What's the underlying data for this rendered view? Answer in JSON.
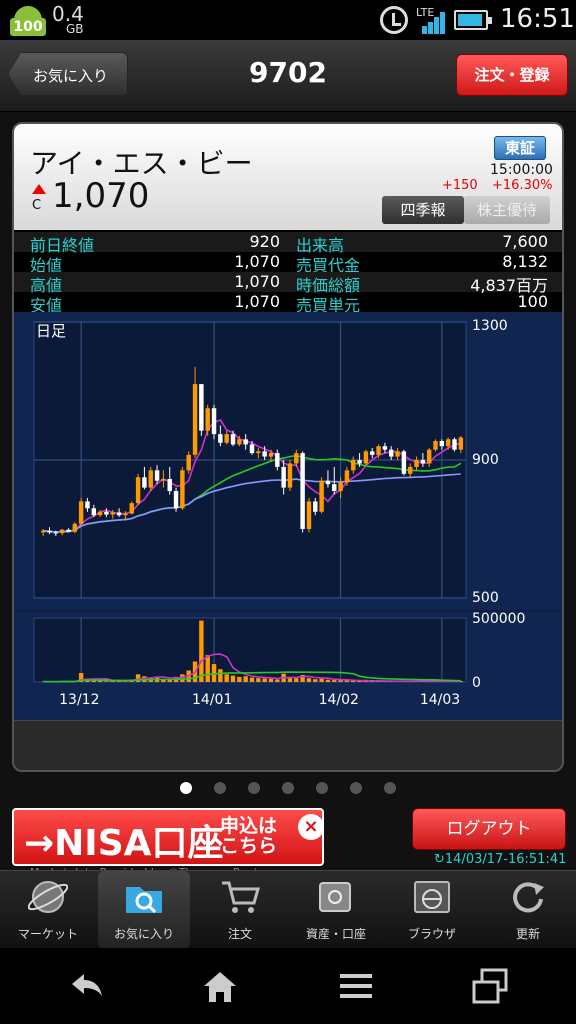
{
  "status_bar": {
    "android_badge": "100",
    "memory": "0.4",
    "memory_unit": "GB",
    "network": "LTE",
    "time": "16:51"
  },
  "header": {
    "back_label": "お気に入り",
    "title": "9702",
    "order_label": "注文・登録"
  },
  "stock": {
    "name": "アイ・エス・ビー",
    "c_mark": "C",
    "price": "1,070",
    "exchange": "東証",
    "price_time": "15:00:00",
    "change": "+150",
    "change_pct": "+16.30%",
    "tab_quarterly": "四季報",
    "tab_yutai": "株主優待"
  },
  "stats": [
    {
      "k1": "前日終値",
      "v1": "920",
      "k2": "出来高",
      "v2": "7,600"
    },
    {
      "k1": "始値",
      "v1": "1,070",
      "k2": "売買代金",
      "v2": "8,132"
    },
    {
      "k1": "高値",
      "v1": "1,070",
      "k2": "時価総額",
      "v2": "4,837百万"
    },
    {
      "k1": "安値",
      "v1": "1,070",
      "k2": "売買単元",
      "v2": "100"
    }
  ],
  "chart": {
    "label": "日足",
    "price_axis": [
      "1300",
      "900",
      "500"
    ],
    "volume_axis": [
      "500000",
      "0"
    ],
    "months": [
      "13/12",
      "14/01",
      "14/02",
      "14/03"
    ],
    "up_color": "#ff9900",
    "down_color": "#ffffff",
    "ma_short_color": "#cc33cc",
    "ma_mid_color": "#22cc22",
    "ma_long_color": "#8899ff"
  },
  "chart_data": {
    "type": "candlestick",
    "price_ticks": [
      1300,
      900,
      500
    ],
    "volume_ticks": [
      500000,
      0
    ],
    "x_tick_labels": [
      "13/12",
      "14/01",
      "14/02",
      "14/03"
    ],
    "ylim": [
      500,
      1300
    ],
    "volume_ylim": [
      0,
      500000
    ],
    "candles": [
      [
        690,
        700,
        680,
        695
      ],
      [
        695,
        705,
        685,
        690
      ],
      [
        690,
        695,
        680,
        688
      ],
      [
        688,
        700,
        682,
        698
      ],
      [
        698,
        702,
        690,
        692
      ],
      [
        692,
        720,
        688,
        715
      ],
      [
        715,
        790,
        710,
        780
      ],
      [
        780,
        790,
        750,
        760
      ],
      [
        760,
        770,
        735,
        740
      ],
      [
        740,
        755,
        735,
        750
      ],
      [
        750,
        760,
        735,
        742
      ],
      [
        742,
        755,
        730,
        748
      ],
      [
        748,
        760,
        735,
        740
      ],
      [
        740,
        752,
        725,
        745
      ],
      [
        745,
        780,
        742,
        775
      ],
      [
        775,
        860,
        770,
        850
      ],
      [
        850,
        880,
        815,
        820
      ],
      [
        820,
        880,
        810,
        870
      ],
      [
        870,
        885,
        830,
        840
      ],
      [
        840,
        870,
        820,
        845
      ],
      [
        845,
        880,
        800,
        810
      ],
      [
        810,
        820,
        750,
        760
      ],
      [
        760,
        880,
        755,
        870
      ],
      [
        870,
        925,
        860,
        915
      ],
      [
        915,
        1170,
        905,
        1120
      ],
      [
        1120,
        1090,
        970,
        985
      ],
      [
        985,
        1060,
        970,
        1050
      ],
      [
        1050,
        1060,
        960,
        975
      ],
      [
        975,
        1000,
        940,
        950
      ],
      [
        950,
        985,
        945,
        975
      ],
      [
        975,
        985,
        940,
        945
      ],
      [
        945,
        970,
        940,
        960
      ],
      [
        960,
        975,
        930,
        945
      ],
      [
        945,
        955,
        915,
        920
      ],
      [
        920,
        935,
        905,
        925
      ],
      [
        925,
        940,
        900,
        910
      ],
      [
        910,
        930,
        895,
        920
      ],
      [
        920,
        930,
        870,
        880
      ],
      [
        880,
        900,
        800,
        820
      ],
      [
        820,
        900,
        810,
        890
      ],
      [
        890,
        930,
        880,
        920
      ],
      [
        920,
        925,
        690,
        700
      ],
      [
        700,
        790,
        690,
        780
      ],
      [
        780,
        790,
        740,
        750
      ],
      [
        750,
        850,
        745,
        840
      ],
      [
        840,
        870,
        820,
        830
      ],
      [
        830,
        880,
        800,
        810
      ],
      [
        810,
        850,
        790,
        835
      ],
      [
        835,
        880,
        825,
        870
      ],
      [
        870,
        910,
        860,
        900
      ],
      [
        900,
        920,
        880,
        890
      ],
      [
        890,
        930,
        885,
        925
      ],
      [
        925,
        935,
        905,
        915
      ],
      [
        915,
        945,
        905,
        940
      ],
      [
        940,
        950,
        920,
        930
      ],
      [
        930,
        940,
        900,
        910
      ],
      [
        910,
        935,
        900,
        925
      ],
      [
        925,
        930,
        855,
        860
      ],
      [
        860,
        890,
        850,
        880
      ],
      [
        880,
        910,
        870,
        900
      ],
      [
        900,
        920,
        880,
        890
      ],
      [
        890,
        935,
        880,
        930
      ],
      [
        930,
        960,
        925,
        955
      ],
      [
        955,
        960,
        930,
        940
      ],
      [
        940,
        965,
        930,
        960
      ],
      [
        960,
        965,
        925,
        930
      ],
      [
        930,
        970,
        920,
        965
      ]
    ],
    "volumes": [
      2000,
      2000,
      3000,
      5000,
      3000,
      4000,
      70000,
      25000,
      15000,
      8000,
      6000,
      10000,
      12000,
      7000,
      20000,
      60000,
      45000,
      30000,
      35000,
      25000,
      22000,
      40000,
      60000,
      90000,
      160000,
      480000,
      210000,
      140000,
      100000,
      60000,
      50000,
      40000,
      45000,
      35000,
      30000,
      28000,
      25000,
      20000,
      65000,
      40000,
      30000,
      55000,
      30000,
      22000,
      25000,
      18000,
      15000,
      14000,
      12000,
      10000,
      9000,
      8000,
      7000,
      8000,
      7000,
      6000,
      5000,
      5000,
      6000,
      7000,
      6000,
      5000,
      5000,
      6000,
      5000,
      6000,
      7600
    ]
  },
  "dots_count": 7,
  "dots_active": 0,
  "nisa": {
    "text": "→NISA口座",
    "sub": "申込は こちら",
    "close": "×"
  },
  "credit": "Market data Provided by ©Thomson Reuters",
  "logout": "ログアウト",
  "refresh_time": "14/03/17-16:51:41",
  "tabs": [
    {
      "label": "マーケット"
    },
    {
      "label": "お気に入り"
    },
    {
      "label": "注文"
    },
    {
      "label": "資産・口座"
    },
    {
      "label": "ブラウザ"
    },
    {
      "label": "更新"
    }
  ]
}
